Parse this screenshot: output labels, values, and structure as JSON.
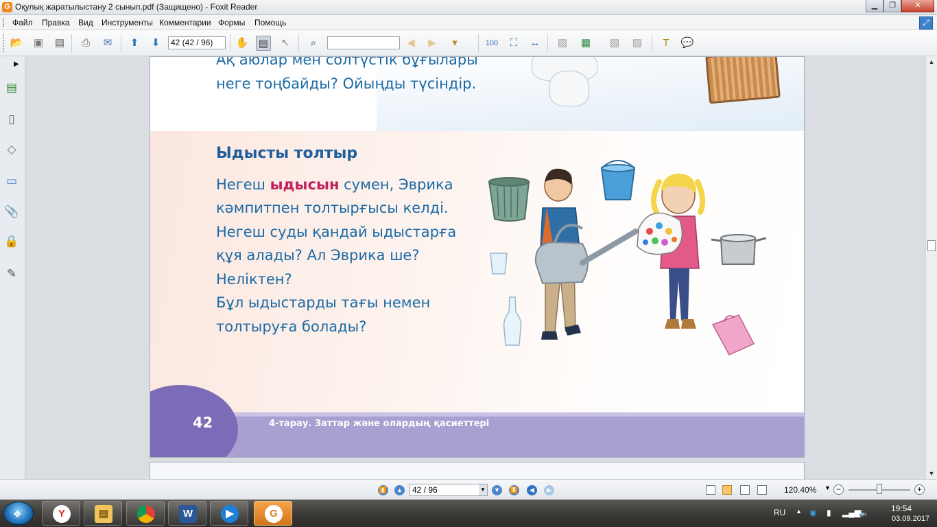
{
  "window": {
    "title": "Оқулық жаратылыстану 2 сынып.pdf (Защищено) - Foxit Reader",
    "app_icon": "G"
  },
  "menu": [
    "Файл",
    "Правка",
    "Вид",
    "Инструменты",
    "Комментарии",
    "Формы",
    "Помощь"
  ],
  "toolbar": {
    "page_field": "42 (42 / 96)",
    "search_field": ""
  },
  "document": {
    "top_text": [
      "Ақ аюлар мен солтүстік бұғылары",
      "неге тоңбайды? Ойыңды түсіндір."
    ],
    "section_title": "Ыдысты толтыр",
    "body": {
      "line1_a": "Негеш ",
      "line1_hl": "ыдысын",
      "line1_b": " сумен,  Эврика",
      "line2": "кәмпитпен толтырғысы келді.",
      "line3": "Негеш суды қандай ыдыстарға",
      "line4": "құя алады? Ал Эврика ше?",
      "line5": "Неліктен?",
      "line6": "Бұл ыдыстарды тағы немен",
      "line7": "толтыруға болады?"
    },
    "page_number": "42",
    "chapter": "4-тарау. Заттар және олардың қасиеттері",
    "colors": {
      "text_blue": "#1b6aa6",
      "highlight": "#c0215d",
      "footer_band": "#a99fd1",
      "footer_circle": "#7c6cb8"
    }
  },
  "status": {
    "page_field": "42 / 96",
    "zoom": "120.40%",
    "zoom_out": "−",
    "zoom_in": "+"
  },
  "taskbar": {
    "lang": "RU",
    "time": "19:54",
    "date": "03.09.2017",
    "apps": [
      "yandex-browser",
      "file-explorer",
      "chrome",
      "word",
      "media-player",
      "foxit-reader"
    ]
  }
}
